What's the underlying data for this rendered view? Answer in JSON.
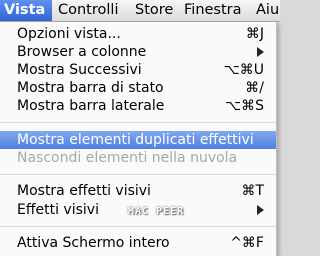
{
  "menubar": {
    "items": [
      {
        "label": "Vista"
      },
      {
        "label": "Controlli"
      },
      {
        "label": "Store"
      },
      {
        "label": "Finestra"
      },
      {
        "label": "Aiu"
      }
    ]
  },
  "menu": {
    "items": [
      {
        "label": "Opzioni vista...",
        "shortcut": "⌘J"
      },
      {
        "label": "Browser a colonne",
        "submenu": true
      },
      {
        "label": "Mostra Successivi",
        "shortcut": "⌥⌘U"
      },
      {
        "label": "Mostra barra di stato",
        "shortcut": "⌘/"
      },
      {
        "label": "Mostra barra laterale",
        "shortcut": "⌥⌘S"
      },
      {
        "label": "Mostra elementi duplicati effettivi",
        "highlighted": true
      },
      {
        "label": "Nascondi elementi nella nuvola",
        "disabled": true
      },
      {
        "label": "Mostra effetti visivi",
        "shortcut": "⌘T"
      },
      {
        "label": "Effetti visivi",
        "submenu": true
      },
      {
        "label": "Attiva Schermo intero",
        "shortcut": "^⌘F"
      }
    ]
  },
  "watermark": "MAC PEER",
  "colors": {
    "highlight": "#5b8ae6",
    "menubar_active": "#3b6fdc",
    "disabled_text": "#a7a7a7"
  }
}
